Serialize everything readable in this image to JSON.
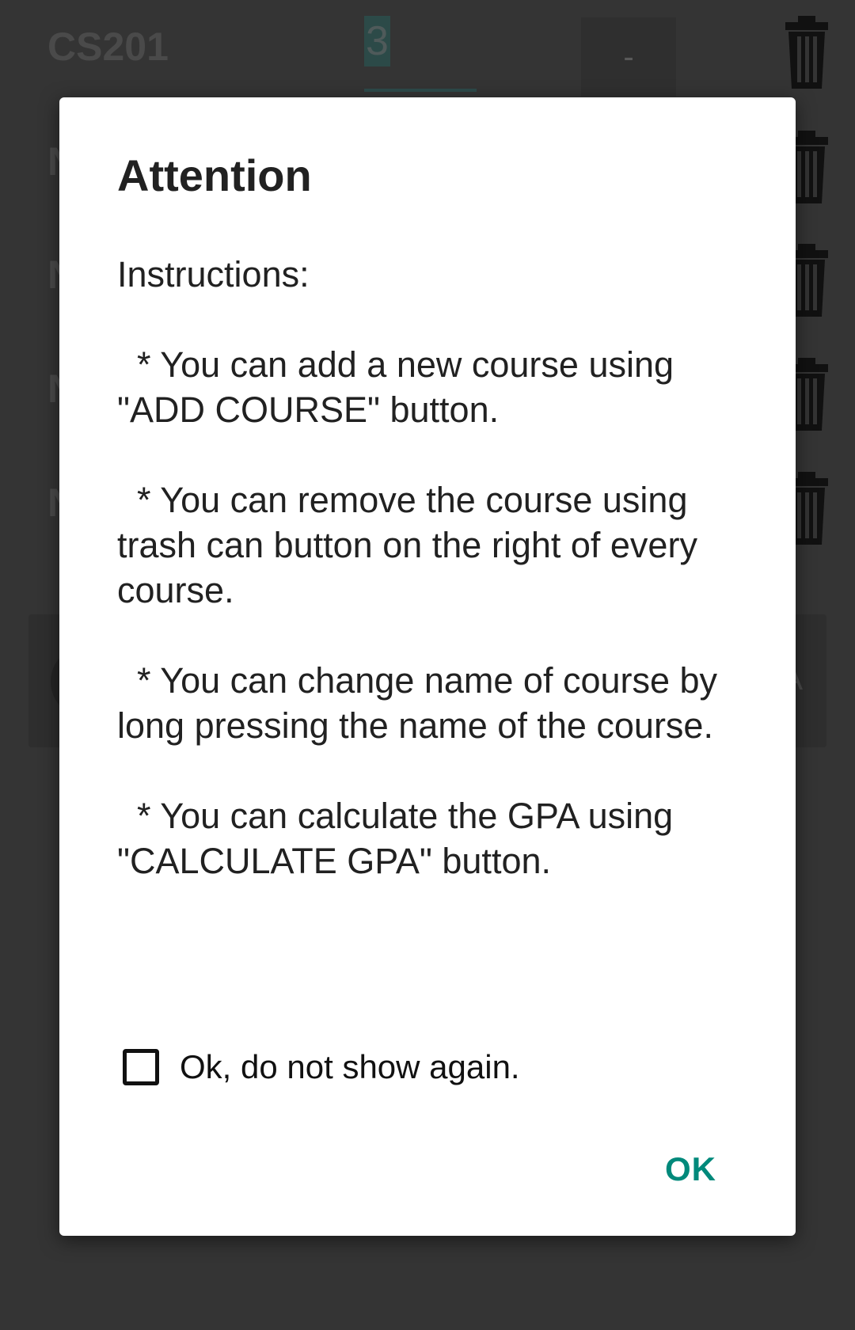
{
  "background": {
    "first_course": {
      "name": "CS201",
      "credit": "3",
      "grade": "-"
    },
    "hidden_row_initials": [
      "N",
      "N",
      "N",
      "N"
    ],
    "action_bar_trailing": "A"
  },
  "dialog": {
    "title": "Attention",
    "message": "Instructions:\n\n  * You can add a new course using \"ADD COURSE\" button.\n\n  * You can remove the course using trash can button on the right of every course.\n\n  * You can change name of course by long pressing the name of the course.\n\n  * You can calculate the GPA using \"CALCULATE GPA\" button.",
    "checkbox_label": "Ok, do not show again.",
    "checkbox_checked": false,
    "ok_label": "OK"
  },
  "colors": {
    "accent": "#00897b",
    "scrim": "#343434",
    "dialog_bg": "#ffffff"
  }
}
